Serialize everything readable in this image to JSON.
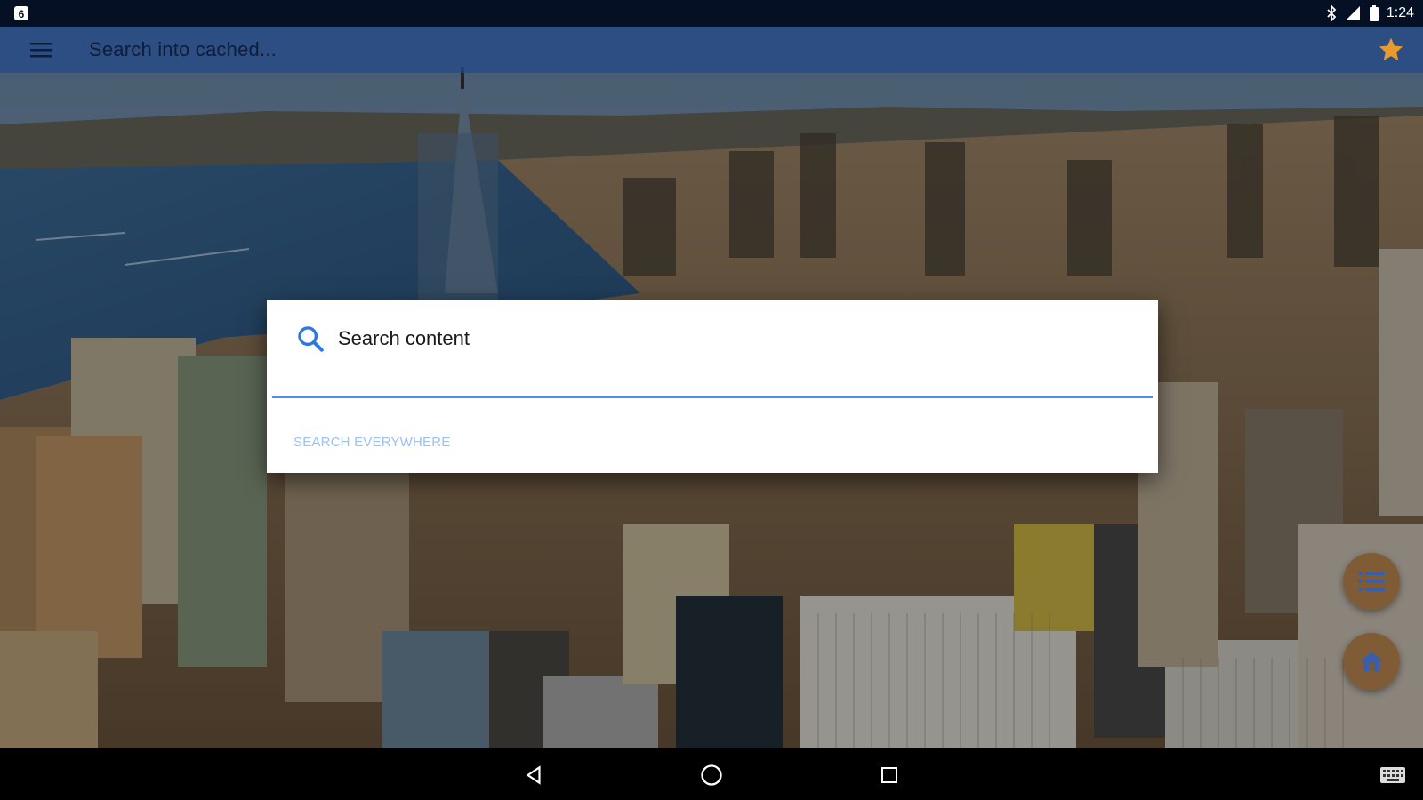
{
  "status_bar": {
    "time": "1:24",
    "icons": [
      "notification-icon",
      "bluetooth-icon",
      "signal-icon",
      "battery-icon"
    ]
  },
  "toolbar": {
    "search_placeholder": "Search into cached...",
    "menu_icon": "menu-icon",
    "favorite_icon": "star-icon"
  },
  "dialog": {
    "title": "Search content",
    "input_value": "",
    "action_label": "SEARCH EVERYWHERE"
  },
  "fabs": {
    "list_icon": "list-icon",
    "home_icon": "home-icon"
  },
  "nav_bar": {
    "buttons": [
      "back-icon",
      "home-circle-icon",
      "recents-icon",
      "keyboard-icon"
    ]
  },
  "colors": {
    "accent": "#e89a2c",
    "toolbar": "#1e3f78",
    "input_underline": "#4c8ff0",
    "action_text": "#9dc1f0",
    "search_icon": "#2f78dd"
  }
}
